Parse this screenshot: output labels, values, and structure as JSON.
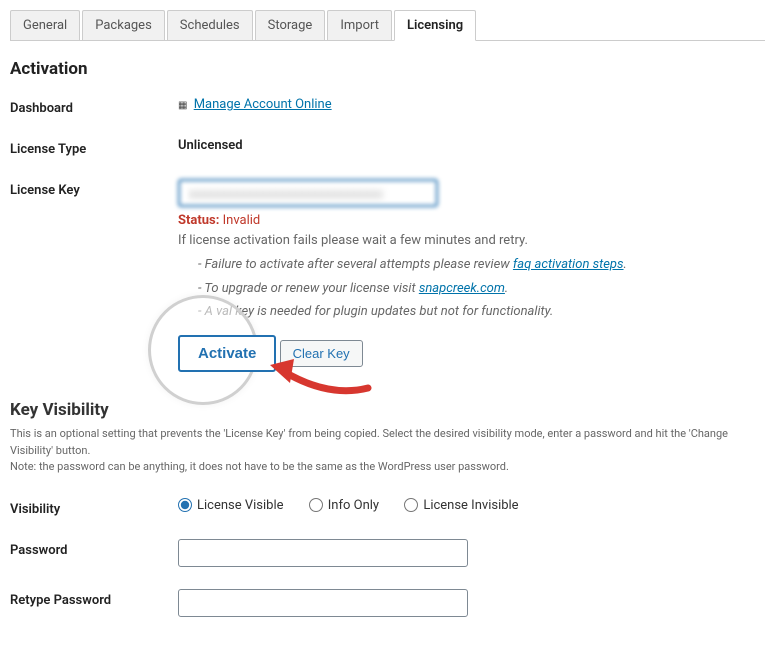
{
  "tabs": {
    "general": "General",
    "packages": "Packages",
    "schedules": "Schedules",
    "storage": "Storage",
    "import": "Import",
    "licensing": "Licensing"
  },
  "section": {
    "activation_title": "Activation"
  },
  "dashboard": {
    "label": "Dashboard",
    "link_text": "Manage Account Online"
  },
  "license_type": {
    "label": "License Type",
    "value": "Unlicensed"
  },
  "license_key": {
    "label": "License Key",
    "input_value": "xxxxxxxxxxxxxxxxxxxxxxxxxxxxxx",
    "status_label": "Status:",
    "status_value": "Invalid",
    "help_line": "If license activation fails please wait a few minutes and retry.",
    "tip1_prefix": "- Failure to activate after several attempts please review ",
    "tip1_link": "faq activation steps",
    "tip1_suffix": ".",
    "tip2_prefix": "- To upgrade or renew your license visit ",
    "tip2_link": "snapcreek.com",
    "tip2_suffix": ".",
    "tip3_prefix": "- A val",
    "tip3_rest": " key is needed for plugin updates but not for functionality."
  },
  "buttons": {
    "activate": "Activate",
    "clear_key": "Clear Key"
  },
  "visibility_section": {
    "title": "Key Visibility",
    "desc1": "This is an optional setting that prevents the 'License Key' from being copied. Select the desired visibility mode, enter a password and hit the 'Change Visibility' button.",
    "desc2": "Note: the password can be anything, it does not have to be the same as the WordPress user password."
  },
  "visibility": {
    "label": "Visibility",
    "opt1": "License Visible",
    "opt2": "Info Only",
    "opt3": "License Invisible"
  },
  "password": {
    "label": "Password"
  },
  "retype_password": {
    "label": "Retype Password"
  }
}
